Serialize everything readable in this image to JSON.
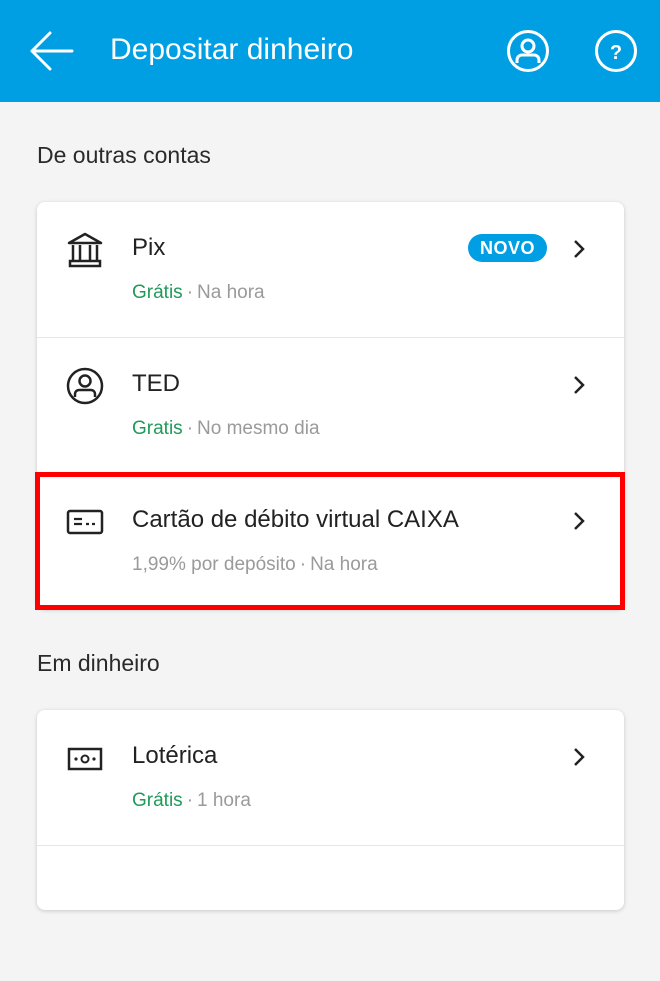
{
  "appbar": {
    "title": "Depositar dinheiro",
    "back_icon": "arrow-left-icon",
    "profile_icon": "user-circle-icon",
    "help_icon": "question-circle-icon",
    "background": "#009ee2"
  },
  "sections": [
    {
      "title": "De outras contas",
      "items": [
        {
          "name": "Pix",
          "icon": "bank-icon",
          "badge": "NOVO",
          "price": "Grátis",
          "separator": "·",
          "time": "Na hora",
          "price_is_free": true
        },
        {
          "name": "TED",
          "icon": "user-circle-icon",
          "price": "Gratis",
          "separator": "·",
          "time": "No mesmo dia",
          "price_is_free": true
        },
        {
          "name": "Cartão de débito virtual CAIXA",
          "icon": "card-icon",
          "price": "1,99% por depósito",
          "separator": "·",
          "time": "Na hora",
          "price_is_free": false,
          "highlighted": true
        }
      ]
    },
    {
      "title": "Em dinheiro",
      "items": [
        {
          "name": "Lotérica",
          "icon": "cash-icon",
          "price": "Grátis",
          "separator": "·",
          "time": "1 hora",
          "price_is_free": true
        }
      ]
    }
  ],
  "colors": {
    "free": "#1f9a5a",
    "muted": "#9a9a9a",
    "highlight": "#ff0000",
    "badge": "#009ee2"
  }
}
